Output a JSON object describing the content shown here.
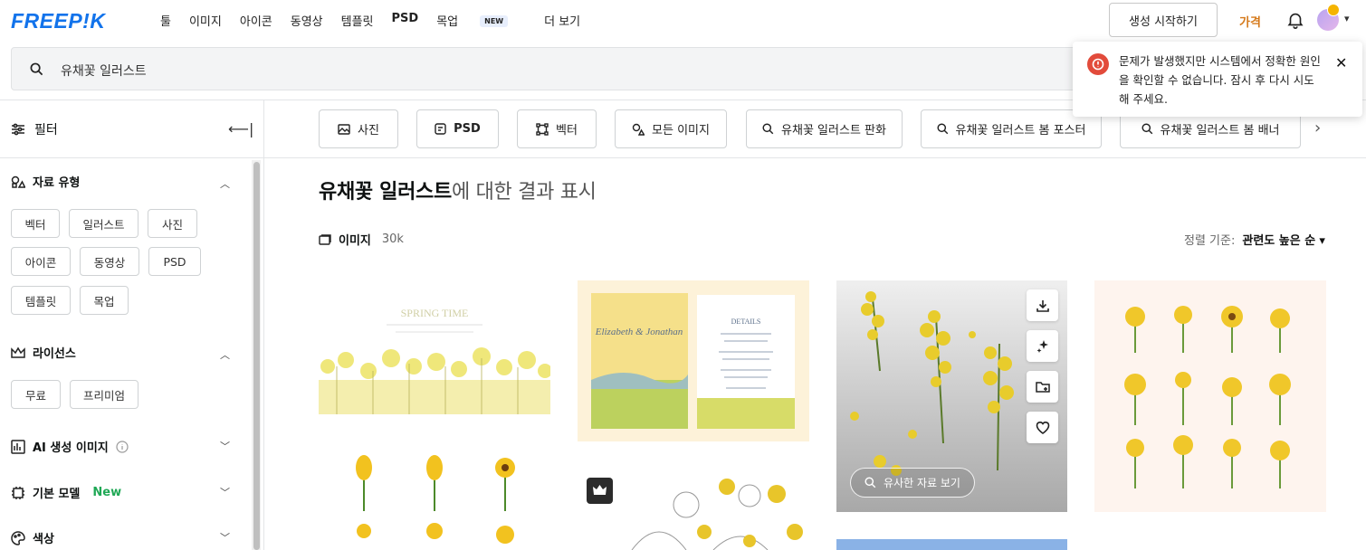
{
  "brand": {
    "logo": "FREEP!K",
    "color": "#1273eb"
  },
  "nav": {
    "items": [
      "툴",
      "이미지",
      "아이콘",
      "동영상",
      "템플릿",
      "PSD",
      "목업",
      "더 보기"
    ],
    "new_badge": "NEW"
  },
  "header": {
    "generate_button": "생성 시작하기",
    "pricing": "가격",
    "bell_icon": "bell-icon"
  },
  "search": {
    "query": "유채꽃 일러스트"
  },
  "toast": {
    "message": "문제가 발생했지만 시스템에서 정확한 원인을 확인할 수 없습니다. 잠시 후 다시 시도해 주세요.",
    "color": "#e24b3b"
  },
  "sidebar": {
    "title": "필터",
    "asset_type": {
      "title": "자료 유형",
      "chips": [
        "벡터",
        "일러스트",
        "사진",
        "아이콘",
        "동영상",
        "PSD",
        "템플릿",
        "목업"
      ]
    },
    "license": {
      "title": "라이선스",
      "chips": [
        "무료",
        "프리미엄"
      ]
    },
    "ai_images": {
      "title": "AI 생성 이미지"
    },
    "base_model": {
      "title": "기본 모델",
      "new_tag": "New"
    },
    "color": {
      "title": "색상"
    }
  },
  "quick_filters": [
    "사진",
    "PSD",
    "벡터",
    "모든 이미지",
    "유채꽃 일러스트 판화",
    "유채꽃 일러스트 봄 포스터",
    "유채꽃 일러스트 봄 배너"
  ],
  "results": {
    "query": "유채꽃 일러스트",
    "suffix": "에 대한 결과 표시",
    "type_label": "이미지",
    "count": "30k",
    "sort_label": "정렬 기준:",
    "sort_value": "관련도 높은 순"
  },
  "card_text": {
    "spring_title": "SPRING TIME",
    "invite_name": "Elizabeth & Jonathan",
    "invite_details": "DETAILS",
    "similar_button": "유사한 자료 보기"
  }
}
